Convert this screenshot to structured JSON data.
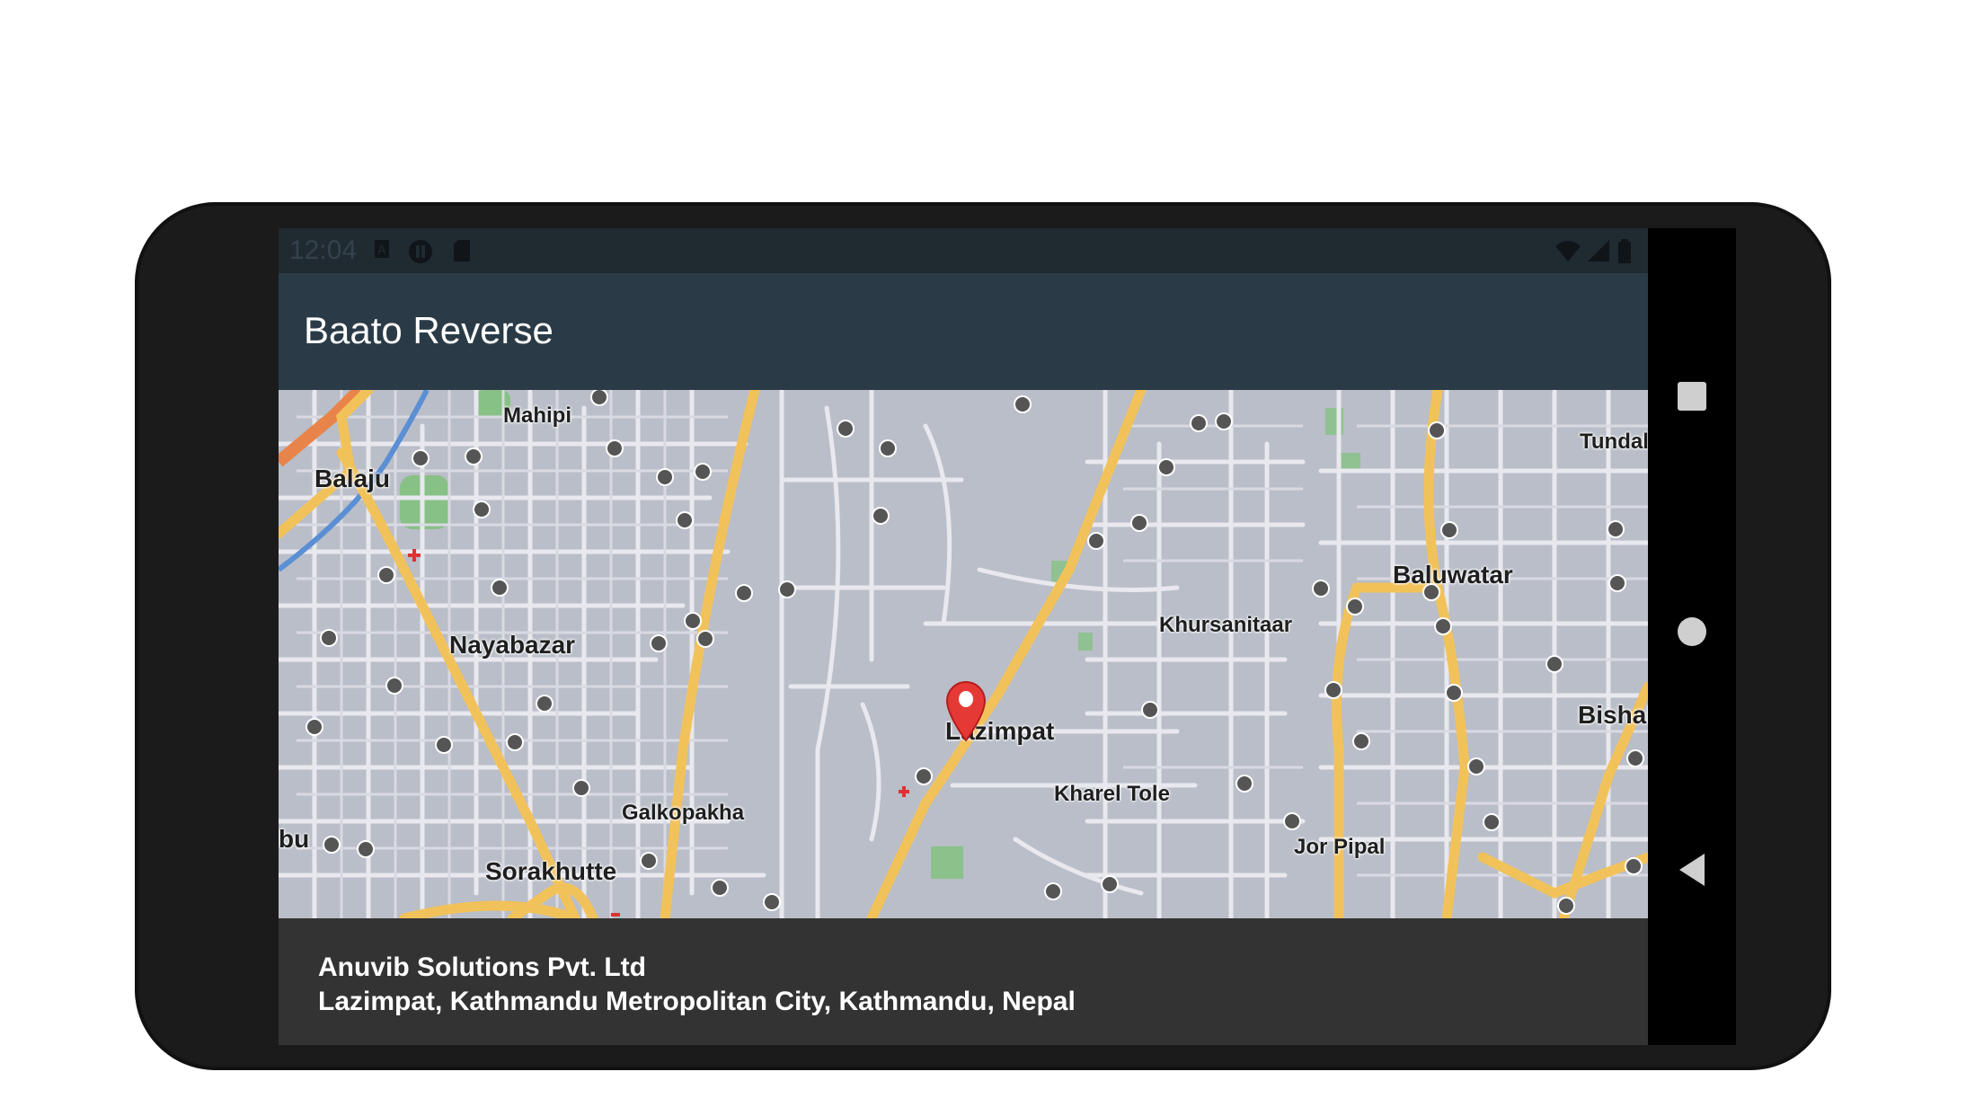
{
  "status_bar": {
    "time": "12:04",
    "left_icons": [
      "a-box-icon",
      "pause-circle-icon",
      "sd-card-icon"
    ],
    "right_icons": [
      "wifi-icon",
      "cell-signal-icon",
      "battery-icon"
    ]
  },
  "app_bar": {
    "title": "Baato Reverse"
  },
  "map": {
    "labels": {
      "mahipi": "Mahipi",
      "balaju": "Balaju",
      "nayabazar": "Nayabazar",
      "lazimpat": "Lazimpat",
      "khursanitaar": "Khursanitaar",
      "baluwatar": "Baluwatar",
      "tundal": "Tundal",
      "bishal": "Bishal",
      "kharel_tole": "Kharel Tole",
      "galkopakha": "Galkopakha",
      "sorakhutte": "Sorakhutte",
      "jor_pipal": "Jor Pipal",
      "bu": "bu"
    },
    "marker_icon": "location-pin-icon",
    "poi_icon": "school-icon"
  },
  "info": {
    "name": "Anuvib Solutions Pvt. Ltd",
    "address": "Lazimpat, Kathmandu Metropolitan City, Kathmandu, Nepal"
  },
  "nav": {
    "recents_icon": "square-icon",
    "home_icon": "circle-icon",
    "back_icon": "triangle-back-icon"
  },
  "colors": {
    "status_bar": "#202a31",
    "app_bar": "#2a3b47",
    "map_base": "#b9bec8",
    "major_road": "#f2c25a",
    "minor_road": "#e8e8ee",
    "park": "#7fc27a",
    "marker": "#e53935",
    "info_bar": "#333333"
  }
}
